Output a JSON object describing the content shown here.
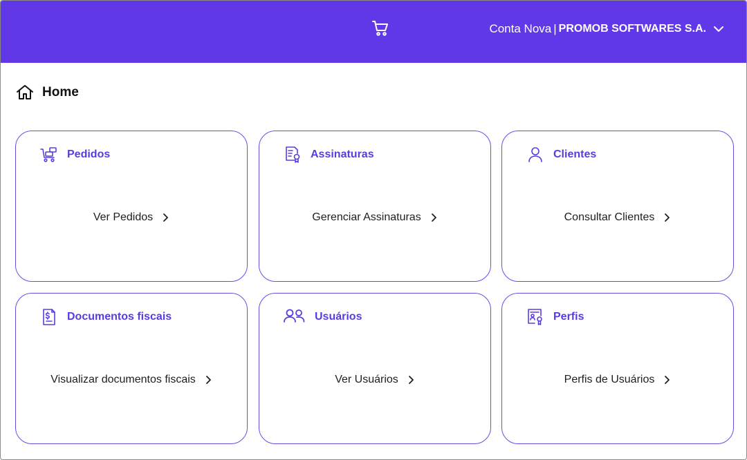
{
  "header": {
    "account_name": "Conta Nova",
    "separator": "|",
    "company": "PROMOB SOFTWARES S.A.",
    "accent_color": "#6038e8"
  },
  "breadcrumb": {
    "title": "Home"
  },
  "cards": [
    {
      "icon": "cart-icon",
      "title": "Pedidos",
      "link": "Ver Pedidos"
    },
    {
      "icon": "certificate-document-icon",
      "title": "Assinaturas",
      "link": "Gerenciar Assinaturas"
    },
    {
      "icon": "user-icon",
      "title": "Clientes",
      "link": "Consultar Clientes"
    },
    {
      "icon": "invoice-dollar-icon",
      "title": "Documentos fiscais",
      "link": "Visualizar documentos fiscais"
    },
    {
      "icon": "users-icon",
      "title": "Usuários",
      "link": "Ver Usuários"
    },
    {
      "icon": "profile-badge-icon",
      "title": "Perfis",
      "link": "Perfis de Usuários"
    }
  ]
}
